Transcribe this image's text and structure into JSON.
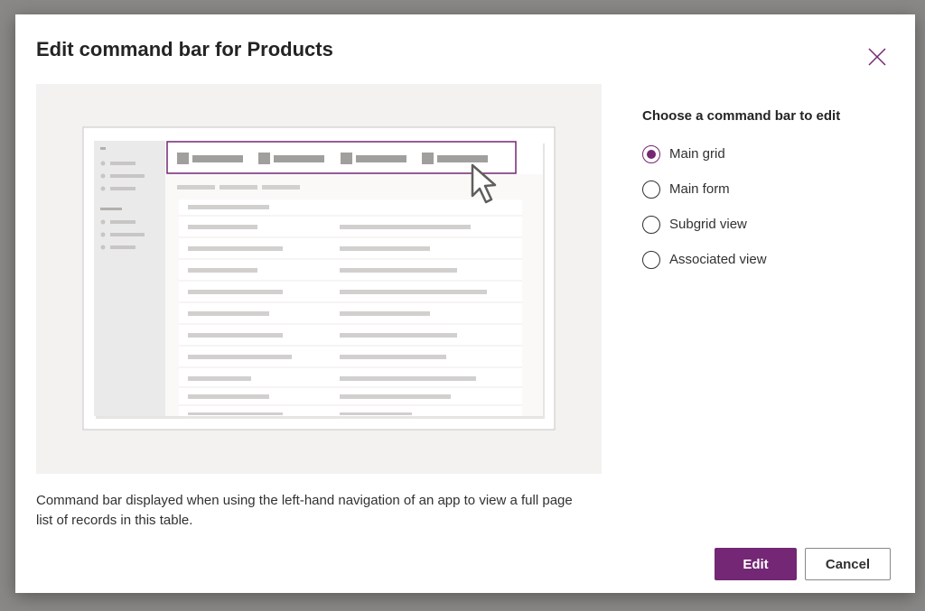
{
  "dialog": {
    "title": "Edit command bar for Products",
    "close_icon": "close-icon",
    "description": "Command bar displayed when using the left-hand navigation of an app to view a full page list of records in this table."
  },
  "options": {
    "label": "Choose a command bar to edit",
    "items": [
      {
        "label": "Main grid",
        "checked": true
      },
      {
        "label": "Main form",
        "checked": false
      },
      {
        "label": "Subgrid view",
        "checked": false
      },
      {
        "label": "Associated view",
        "checked": false
      }
    ]
  },
  "buttons": {
    "edit_label": "Edit",
    "cancel_label": "Cancel"
  },
  "colors": {
    "accent": "#742774",
    "overlay": "#8a8886",
    "preview_bg": "#f3f2f1"
  }
}
